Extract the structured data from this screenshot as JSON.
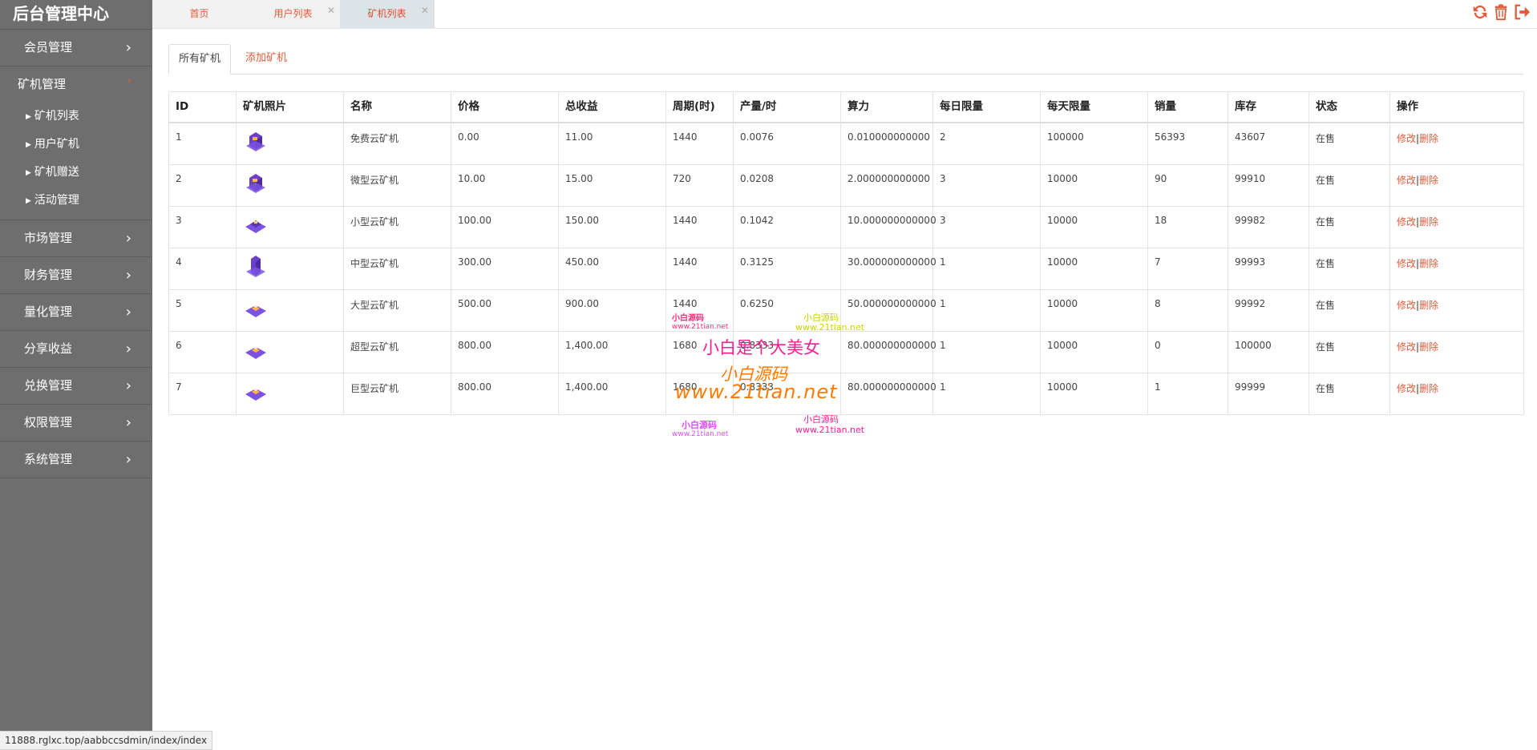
{
  "app": {
    "title": "后台管理中心"
  },
  "sidebar": {
    "groups": [
      {
        "label": "会员管理"
      },
      {
        "label": "矿机管理"
      },
      {
        "label": "市场管理"
      },
      {
        "label": "财务管理"
      },
      {
        "label": "量化管理"
      },
      {
        "label": "分享收益"
      },
      {
        "label": "兑换管理"
      },
      {
        "label": "权限管理"
      },
      {
        "label": "系统管理"
      }
    ],
    "submenu": [
      "矿机列表",
      "用户矿机",
      "矿机赠送",
      "活动管理"
    ],
    "chevron": "›"
  },
  "tabs": [
    {
      "label": "首页"
    },
    {
      "label": "用户列表"
    },
    {
      "label": "矿机列表"
    }
  ],
  "toolbar": {
    "icons": [
      "refresh-icon",
      "trash-icon",
      "logout-icon"
    ],
    "color": "#e05b3a"
  },
  "subtabs": [
    {
      "label": "所有矿机"
    },
    {
      "label": "添加矿机"
    }
  ],
  "table": {
    "headers": [
      "ID",
      "矿机照片",
      "名称",
      "价格",
      "总收益",
      "周期(时)",
      "产量/时",
      "算力",
      "每日限量",
      "每天限量",
      "销量",
      "库存",
      "状态",
      "操作"
    ],
    "rows": [
      {
        "id": "1",
        "name": "免费云矿机",
        "price": "0.00",
        "total": "11.00",
        "cycle": "1440",
        "yield": "0.0076",
        "power": "0.010000000000",
        "daily": "2",
        "daylimit": "100000",
        "sales": "56393",
        "stock": "43607",
        "status": "在售",
        "edit": "修改",
        "del": "删除"
      },
      {
        "id": "2",
        "name": "微型云矿机",
        "price": "10.00",
        "total": "15.00",
        "cycle": "720",
        "yield": "0.0208",
        "power": "2.000000000000",
        "daily": "3",
        "daylimit": "10000",
        "sales": "90",
        "stock": "99910",
        "status": "在售",
        "edit": "修改",
        "del": "删除"
      },
      {
        "id": "3",
        "name": "小型云矿机",
        "price": "100.00",
        "total": "150.00",
        "cycle": "1440",
        "yield": "0.1042",
        "power": "10.000000000000",
        "daily": "3",
        "daylimit": "10000",
        "sales": "18",
        "stock": "99982",
        "status": "在售",
        "edit": "修改",
        "del": "删除"
      },
      {
        "id": "4",
        "name": "中型云矿机",
        "price": "300.00",
        "total": "450.00",
        "cycle": "1440",
        "yield": "0.3125",
        "power": "30.000000000000",
        "daily": "1",
        "daylimit": "10000",
        "sales": "7",
        "stock": "99993",
        "status": "在售",
        "edit": "修改",
        "del": "删除"
      },
      {
        "id": "5",
        "name": "大型云矿机",
        "price": "500.00",
        "total": "900.00",
        "cycle": "1440",
        "yield": "0.6250",
        "power": "50.000000000000",
        "daily": "1",
        "daylimit": "10000",
        "sales": "8",
        "stock": "99992",
        "status": "在售",
        "edit": "修改",
        "del": "删除"
      },
      {
        "id": "6",
        "name": "超型云矿机",
        "price": "800.00",
        "total": "1,400.00",
        "cycle": "1680",
        "yield": "0.8333",
        "power": "80.000000000000",
        "daily": "1",
        "daylimit": "10000",
        "sales": "0",
        "stock": "100000",
        "status": "在售",
        "edit": "修改",
        "del": "删除"
      },
      {
        "id": "7",
        "name": "巨型云矿机",
        "price": "800.00",
        "total": "1,400.00",
        "cycle": "1680",
        "yield": "0.8333",
        "power": "80.000000000000",
        "daily": "1",
        "daylimit": "10000",
        "sales": "1",
        "stock": "99999",
        "status": "在售",
        "edit": "修改",
        "del": "删除"
      }
    ]
  },
  "watermark": {
    "line1": "小白源码",
    "url_small": "www.21tian.net",
    "big": "小白是个大美女",
    "mid": "小白源码",
    "url_big": "www.21tian.net"
  },
  "statusbar": {
    "url": "11888.rglxc.top/aabbccsdmin/index/index"
  }
}
